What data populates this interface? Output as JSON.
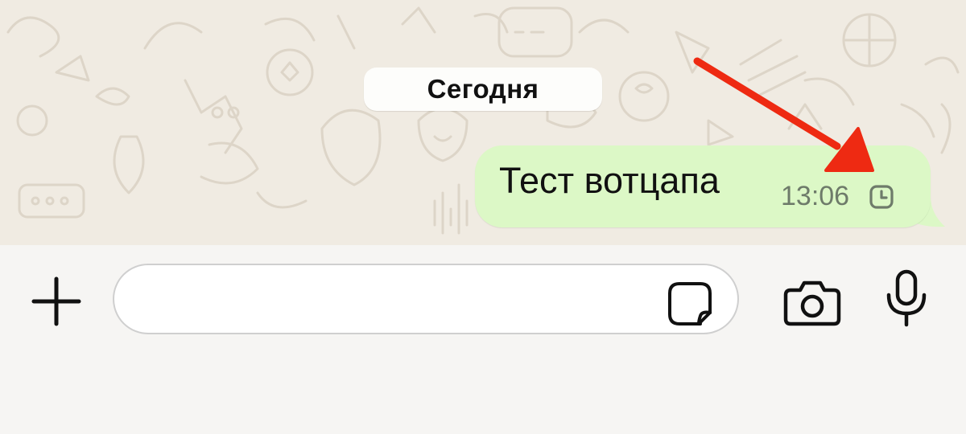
{
  "chat": {
    "date_separator": "Сегодня",
    "message": {
      "text": "Тест вотцапа",
      "time": "13:06",
      "status_icon": "clock-pending-icon"
    },
    "annotation": {
      "type": "arrow",
      "color": "#ee2a12",
      "points_to": "clock-pending-icon"
    }
  },
  "composer": {
    "input_value": "",
    "icons": [
      "plus-icon",
      "sticker-icon",
      "camera-icon",
      "microphone-icon"
    ]
  },
  "colors": {
    "wallpaper": "#f0ebe2",
    "bubble_outgoing": "#dcf8c6",
    "date_pill": "#fdfdfb",
    "composer_bg": "#f6f5f3"
  }
}
